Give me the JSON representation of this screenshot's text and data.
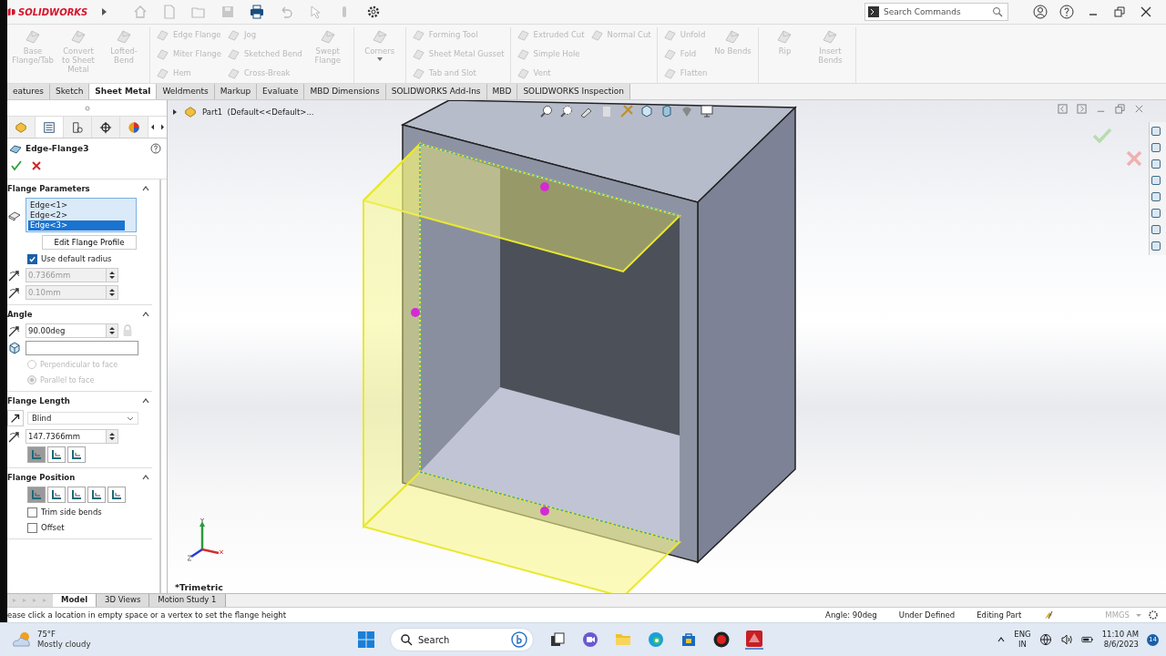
{
  "app": {
    "name": "SOLIDWORKS"
  },
  "search": {
    "placeholder": "Search Commands"
  },
  "ribbon": [
    {
      "columns": [
        {
          "kind": "large",
          "tools": [
            {
              "label": "Base Flange/Tab",
              "disabled": true
            }
          ]
        },
        {
          "kind": "large",
          "tools": [
            {
              "label": "Convert to Sheet Metal",
              "disabled": true
            }
          ]
        },
        {
          "kind": "large",
          "tools": [
            {
              "label": "Lofted-Bend",
              "disabled": true
            }
          ]
        }
      ]
    },
    {
      "columns": [
        {
          "kind": "stack",
          "tools": [
            {
              "label": "Edge Flange",
              "disabled": true
            },
            {
              "label": "Miter Flange",
              "disabled": true
            },
            {
              "label": "Hem",
              "disabled": true
            }
          ]
        },
        {
          "kind": "stack",
          "tools": [
            {
              "label": "Jog",
              "disabled": true
            },
            {
              "label": "Sketched Bend",
              "disabled": true
            },
            {
              "label": "Cross-Break",
              "disabled": true
            }
          ]
        },
        {
          "kind": "large",
          "tools": [
            {
              "label": "Swept Flange",
              "disabled": true
            }
          ]
        }
      ]
    },
    {
      "columns": [
        {
          "kind": "large",
          "tools": [
            {
              "label": "Corners",
              "disabled": true
            }
          ]
        }
      ]
    },
    {
      "columns": [
        {
          "kind": "stack",
          "tools": [
            {
              "label": "Forming Tool",
              "disabled": true
            },
            {
              "label": "Sheet Metal Gusset",
              "disabled": true
            },
            {
              "label": "Tab and Slot",
              "disabled": true
            }
          ]
        }
      ]
    },
    {
      "columns": [
        {
          "kind": "stack",
          "tools": [
            {
              "label": "Extruded Cut",
              "disabled": true
            },
            {
              "label": "Simple Hole",
              "disabled": true
            },
            {
              "label": "Vent",
              "disabled": true
            }
          ]
        },
        {
          "kind": "stack",
          "tools": [
            {
              "label": "Normal Cut",
              "disabled": true
            }
          ]
        }
      ]
    },
    {
      "columns": [
        {
          "kind": "stack",
          "tools": [
            {
              "label": "Unfold",
              "disabled": true
            },
            {
              "label": "Fold",
              "disabled": true
            },
            {
              "label": "Flatten",
              "disabled": true
            }
          ]
        },
        {
          "kind": "large",
          "tools": [
            {
              "label": "No Bends",
              "disabled": true
            }
          ]
        }
      ]
    },
    {
      "columns": [
        {
          "kind": "large",
          "tools": [
            {
              "label": "Rip",
              "disabled": true
            }
          ]
        },
        {
          "kind": "large",
          "tools": [
            {
              "label": "Insert Bends",
              "disabled": true
            }
          ]
        }
      ]
    }
  ],
  "tabs": [
    {
      "label": "eatures",
      "selected": false
    },
    {
      "label": "Sketch",
      "selected": false
    },
    {
      "label": "Sheet Metal",
      "selected": true
    },
    {
      "label": "Weldments",
      "selected": false
    },
    {
      "label": "Markup",
      "selected": false
    },
    {
      "label": "Evaluate",
      "selected": false
    },
    {
      "label": "MBD Dimensions",
      "selected": false
    },
    {
      "label": "SOLIDWORKS Add-Ins",
      "selected": false
    },
    {
      "label": "MBD",
      "selected": false
    },
    {
      "label": "SOLIDWORKS Inspection",
      "selected": false
    }
  ],
  "property_manager": {
    "title": "Edge-Flange3",
    "sections": [
      {
        "title": "Flange Parameters",
        "expanded": true,
        "items": [
          {
            "kind": "selection-list",
            "entries": [
              {
                "label": "Edge<1>",
                "selected": false
              },
              {
                "label": "Edge<2>",
                "selected": false
              },
              {
                "label": "Edge<3>",
                "selected": true
              }
            ]
          },
          {
            "kind": "button",
            "label": "Edit Flange Profile"
          },
          {
            "kind": "checkbox",
            "label": "Use default radius",
            "checked": true
          },
          {
            "kind": "spin-field",
            "value": "0.7366mm",
            "disabled": true
          },
          {
            "kind": "spin-field",
            "value": "0.10mm",
            "disabled": true
          }
        ]
      },
      {
        "title": "Angle",
        "expanded": true,
        "items": [
          {
            "kind": "spin-field",
            "value": "90.00deg",
            "disabled": false,
            "lock": true
          },
          {
            "kind": "text-field"
          },
          {
            "kind": "radio",
            "label": "Perpendicular to face",
            "selected": false,
            "disabled": true
          },
          {
            "kind": "radio",
            "label": "Parallel to face",
            "selected": true,
            "disabled": true
          }
        ]
      },
      {
        "title": "Flange Length",
        "expanded": true,
        "items": [
          {
            "kind": "dropdown",
            "value": "Blind"
          },
          {
            "kind": "spin-field",
            "value": "147.7366mm",
            "disabled": false
          },
          {
            "kind": "icon-buttons",
            "buttons": [
              {
                "selected": true
              },
              {
                "selected": false
              },
              {
                "selected": false
              }
            ]
          }
        ]
      },
      {
        "title": "Flange Position",
        "expanded": true,
        "items": [
          {
            "kind": "icon-buttons",
            "buttons": [
              {
                "selected": true
              },
              {
                "selected": false
              },
              {
                "selected": false
              },
              {
                "selected": false
              },
              {
                "selected": false
              }
            ]
          },
          {
            "kind": "checkbox",
            "label": "Trim side bends",
            "checked": false
          },
          {
            "kind": "checkbox",
            "label": "Offset",
            "checked": false
          }
        ]
      }
    ]
  },
  "tree": {
    "label": "Part1  (Default<<Default>..."
  },
  "view": {
    "orientation": "*Trimetric"
  },
  "bottom_tabs": [
    {
      "label": "Model",
      "selected": true
    },
    {
      "label": "3D Views",
      "selected": false
    },
    {
      "label": "Motion Study 1",
      "selected": false
    }
  ],
  "status_bar": {
    "message": "ease click a location in empty space or a vertex to set the flange height",
    "items": [
      "Angle: 90deg",
      "Under Defined",
      "Editing Part"
    ],
    "units": "MMGS"
  },
  "taskbar": {
    "weather": {
      "temp": "75°F",
      "condition": "Mostly cloudy"
    },
    "search": "Search",
    "language": [
      "ENG",
      "IN"
    ],
    "time": "11:10 AM",
    "date": "8/6/2023",
    "notifications": "14"
  }
}
